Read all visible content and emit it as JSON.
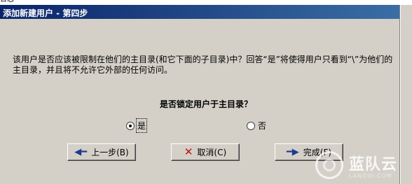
{
  "top_strip": {
    "text": "日志"
  },
  "window": {
    "title": "添加新建用户 - 第四步"
  },
  "description": "该用户是否应该被限制在他们的主目录(和它下面的子目录)中？回答“是”将使得用户只看到“\\”为他们的主目录，并且将不允许它外部的任何访问。",
  "question": "是否锁定用户于主目录？",
  "options": {
    "yes": {
      "label": "是",
      "checked": true
    },
    "no": {
      "label": "否",
      "checked": false
    }
  },
  "buttons": {
    "back": {
      "label": "上一步(B)",
      "icon": "arrow-left-icon"
    },
    "cancel": {
      "label": "取消(C)",
      "icon": "x-icon"
    },
    "finish": {
      "label": "完成(F)",
      "icon": "arrow-right-icon"
    }
  },
  "watermark": {
    "text": "蓝队云",
    "sub": "LANDUI.COM"
  }
}
